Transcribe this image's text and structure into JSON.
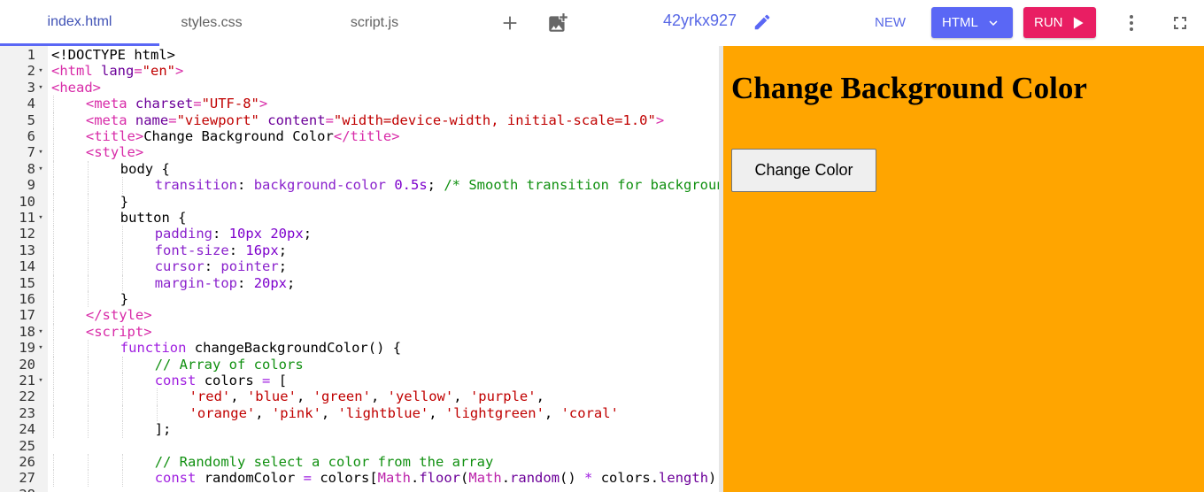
{
  "tabs": [
    {
      "label": "index.html",
      "active": true
    },
    {
      "label": "styles.css",
      "active": false
    },
    {
      "label": "script.js",
      "active": false
    }
  ],
  "toolbar": {
    "project_name": "42yrkx927",
    "new_label": "NEW",
    "html_label": "HTML",
    "run_label": "RUN",
    "icons": [
      "add-icon",
      "add-image-icon",
      "pencil-icon",
      "chevron-down-icon",
      "play-icon",
      "more-vert-icon",
      "fullscreen-icon"
    ]
  },
  "colors": {
    "accent": "#5a67f5",
    "run": "#e91e63",
    "preview_background": "#ffa500"
  },
  "editor": {
    "lines": [
      {
        "n": "1",
        "fold": false,
        "indent": 0,
        "tokens": [
          [
            "",
            "<!DOCTYPE html>"
          ]
        ]
      },
      {
        "n": "2",
        "fold": true,
        "indent": 0,
        "tokens": [
          [
            "t-tag",
            "<html "
          ],
          [
            "t-attr",
            "lang"
          ],
          [
            "t-tag",
            "="
          ],
          [
            "t-str",
            "\"en\""
          ],
          [
            "t-tag",
            ">"
          ]
        ]
      },
      {
        "n": "3",
        "fold": true,
        "indent": 0,
        "tokens": [
          [
            "t-tag",
            "<head>"
          ]
        ]
      },
      {
        "n": "4",
        "fold": false,
        "indent": 1,
        "tokens": [
          [
            "t-tag",
            "<meta "
          ],
          [
            "t-attr",
            "charset"
          ],
          [
            "t-tag",
            "="
          ],
          [
            "t-str",
            "\"UTF-8\""
          ],
          [
            "t-tag",
            ">"
          ]
        ]
      },
      {
        "n": "5",
        "fold": false,
        "indent": 1,
        "tokens": [
          [
            "t-tag",
            "<meta "
          ],
          [
            "t-attr",
            "name"
          ],
          [
            "t-tag",
            "="
          ],
          [
            "t-str",
            "\"viewport\""
          ],
          [
            "",
            " "
          ],
          [
            "t-attr",
            "content"
          ],
          [
            "t-tag",
            "="
          ],
          [
            "t-str",
            "\"width=device-width, initial-scale=1.0\""
          ],
          [
            "t-tag",
            ">"
          ]
        ]
      },
      {
        "n": "6",
        "fold": false,
        "indent": 1,
        "tokens": [
          [
            "t-tag",
            "<title>"
          ],
          [
            "",
            "Change Background Color"
          ],
          [
            "t-tag",
            "</title>"
          ]
        ]
      },
      {
        "n": "7",
        "fold": true,
        "indent": 1,
        "tokens": [
          [
            "t-tag",
            "<style>"
          ]
        ]
      },
      {
        "n": "8",
        "fold": true,
        "indent": 2,
        "tokens": [
          [
            "",
            "body {"
          ]
        ]
      },
      {
        "n": "9",
        "fold": false,
        "indent": 3,
        "tokens": [
          [
            "t-prop",
            "transition"
          ],
          [
            "",
            ": "
          ],
          [
            "t-prop",
            "background-color "
          ],
          [
            "t-num",
            "0.5s"
          ],
          [
            "",
            "; "
          ],
          [
            "t-com",
            "/* Smooth transition for background color change */"
          ]
        ]
      },
      {
        "n": "10",
        "fold": false,
        "indent": 2,
        "tokens": [
          [
            "",
            "}"
          ]
        ]
      },
      {
        "n": "11",
        "fold": true,
        "indent": 2,
        "tokens": [
          [
            "",
            "button {"
          ]
        ]
      },
      {
        "n": "12",
        "fold": false,
        "indent": 3,
        "tokens": [
          [
            "t-prop",
            "padding"
          ],
          [
            "",
            ": "
          ],
          [
            "t-num",
            "10px 20px"
          ],
          [
            "",
            ";"
          ]
        ]
      },
      {
        "n": "13",
        "fold": false,
        "indent": 3,
        "tokens": [
          [
            "t-prop",
            "font-size"
          ],
          [
            "",
            ": "
          ],
          [
            "t-num",
            "16px"
          ],
          [
            "",
            ";"
          ]
        ]
      },
      {
        "n": "14",
        "fold": false,
        "indent": 3,
        "tokens": [
          [
            "t-prop",
            "cursor"
          ],
          [
            "",
            ": "
          ],
          [
            "t-prop",
            "pointer"
          ],
          [
            "",
            ";"
          ]
        ]
      },
      {
        "n": "15",
        "fold": false,
        "indent": 3,
        "tokens": [
          [
            "t-prop",
            "margin-top"
          ],
          [
            "",
            ": "
          ],
          [
            "t-num",
            "20px"
          ],
          [
            "",
            ";"
          ]
        ]
      },
      {
        "n": "16",
        "fold": false,
        "indent": 2,
        "tokens": [
          [
            "",
            "}"
          ]
        ]
      },
      {
        "n": "17",
        "fold": false,
        "indent": 1,
        "tokens": [
          [
            "t-tag",
            "</style>"
          ]
        ]
      },
      {
        "n": "18",
        "fold": true,
        "indent": 1,
        "tokens": [
          [
            "t-tag",
            "<script>"
          ]
        ]
      },
      {
        "n": "19",
        "fold": true,
        "indent": 2,
        "tokens": [
          [
            "t-kw",
            "function "
          ],
          [
            "",
            "changeBackgroundColor() {"
          ]
        ]
      },
      {
        "n": "20",
        "fold": false,
        "indent": 3,
        "tokens": [
          [
            "t-com",
            "// Array of colors"
          ]
        ]
      },
      {
        "n": "21",
        "fold": true,
        "indent": 3,
        "tokens": [
          [
            "t-kw",
            "const "
          ],
          [
            "",
            "colors "
          ],
          [
            "t-kw",
            "= "
          ],
          [
            "",
            "["
          ]
        ]
      },
      {
        "n": "22",
        "fold": false,
        "indent": 4,
        "tokens": [
          [
            "t-str",
            "'red'"
          ],
          [
            "",
            ", "
          ],
          [
            "t-str",
            "'blue'"
          ],
          [
            "",
            ", "
          ],
          [
            "t-str",
            "'green'"
          ],
          [
            "",
            ", "
          ],
          [
            "t-str",
            "'yellow'"
          ],
          [
            "",
            ", "
          ],
          [
            "t-str",
            "'purple'"
          ],
          [
            "",
            ","
          ]
        ]
      },
      {
        "n": "23",
        "fold": false,
        "indent": 4,
        "tokens": [
          [
            "t-str",
            "'orange'"
          ],
          [
            "",
            ", "
          ],
          [
            "t-str",
            "'pink'"
          ],
          [
            "",
            ", "
          ],
          [
            "t-str",
            "'lightblue'"
          ],
          [
            "",
            ", "
          ],
          [
            "t-str",
            "'lightgreen'"
          ],
          [
            "",
            ", "
          ],
          [
            "t-str",
            "'coral'"
          ]
        ]
      },
      {
        "n": "24",
        "fold": false,
        "indent": 3,
        "tokens": [
          [
            "",
            "];"
          ]
        ]
      },
      {
        "n": "25",
        "fold": false,
        "indent": 0,
        "tokens": []
      },
      {
        "n": "26",
        "fold": false,
        "indent": 3,
        "tokens": [
          [
            "t-com",
            "// Randomly select a color from the array"
          ]
        ]
      },
      {
        "n": "27",
        "fold": false,
        "indent": 3,
        "tokens": [
          [
            "t-kw",
            "const "
          ],
          [
            "",
            "randomColor "
          ],
          [
            "t-kw",
            "= "
          ],
          [
            "",
            "colors["
          ],
          [
            "t-math",
            "Math"
          ],
          [
            "",
            "."
          ],
          [
            "t-attr",
            "floor"
          ],
          [
            "",
            "("
          ],
          [
            "t-math",
            "Math"
          ],
          [
            "",
            "."
          ],
          [
            "t-attr",
            "random"
          ],
          [
            "",
            "() "
          ],
          [
            "t-kw",
            "* "
          ],
          [
            "",
            "colors."
          ],
          [
            "t-attr",
            "length"
          ],
          [
            "",
            ")];"
          ]
        ]
      },
      {
        "n": "28",
        "fold": false,
        "indent": 0,
        "tokens": []
      }
    ]
  },
  "preview": {
    "heading": "Change Background Color",
    "button_label": "Change Color"
  }
}
